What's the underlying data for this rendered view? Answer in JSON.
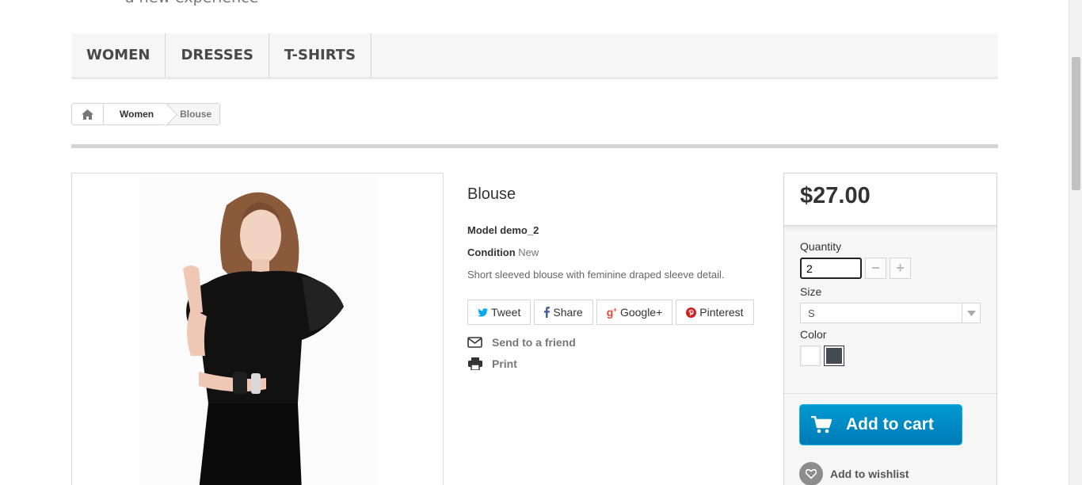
{
  "header": {
    "tagline": "a new experience"
  },
  "menu": {
    "items": [
      {
        "label": "WOMEN"
      },
      {
        "label": "DRESSES"
      },
      {
        "label": "T-SHIRTS"
      }
    ]
  },
  "breadcrumb": {
    "home_icon": "home-icon",
    "items": [
      {
        "label": "Women"
      }
    ],
    "current": "Blouse"
  },
  "product": {
    "title": "Blouse",
    "model_label": "Model",
    "model_value": "demo_2",
    "condition_label": "Condition",
    "condition_value": "New",
    "short_description": "Short sleeved blouse with feminine draped sleeve detail."
  },
  "social": {
    "tweet": "Tweet",
    "share": "Share",
    "googleplus": "Google+",
    "pinterest": "Pinterest",
    "colors": {
      "twitter": "#00aaf0",
      "facebook": "#435f9f",
      "google": "#e04b34",
      "pinterest": "#ce1f21"
    }
  },
  "actions": {
    "send_to_friend": "Send to a friend",
    "print": "Print"
  },
  "buy": {
    "price": "$27.00",
    "quantity_label": "Quantity",
    "quantity_value": "2",
    "size_label": "Size",
    "size_value": "S",
    "color_label": "Color",
    "colors": [
      {
        "name": "White",
        "hex": "#ffffff",
        "selected": false
      },
      {
        "name": "Black",
        "hex": "#434a54",
        "selected": true
      }
    ],
    "add_to_cart": "Add to cart",
    "add_to_wishlist": "Add to wishlist",
    "accent_color": "#0093cf"
  }
}
